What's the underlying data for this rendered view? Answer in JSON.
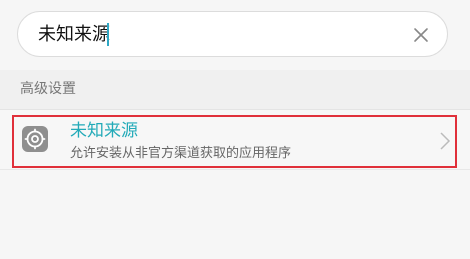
{
  "search": {
    "query": "未知来源",
    "clear_icon": "close-icon"
  },
  "section": {
    "title": "高级设置"
  },
  "result": {
    "icon": "gear-icon",
    "title": "未知来源",
    "subtitle": "允许安装从非官方渠道获取的应用程序",
    "chevron_icon": "chevron-right-icon",
    "highlighted": true
  },
  "colors": {
    "accent": "#22aab8",
    "highlight": "#e0303a",
    "caret": "#2ea7c4"
  }
}
